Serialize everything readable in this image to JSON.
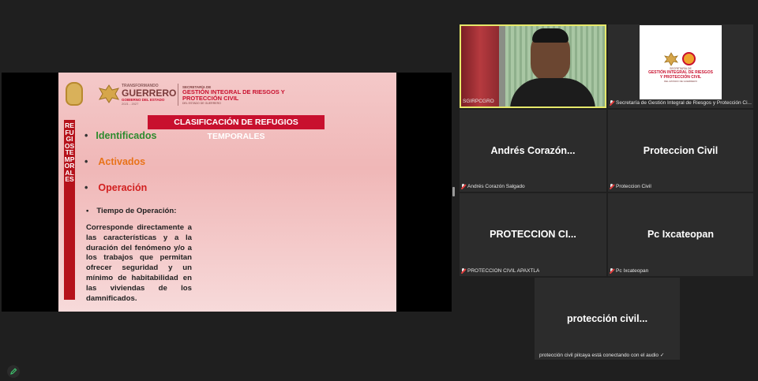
{
  "slide": {
    "logo_line1": "TRANSFORMANDO",
    "logo_line2": "GUERRERO",
    "logo_line3": "GOBIERNO DEL ESTADO",
    "logo_line4": "2021 - 2027",
    "sec_line1": "SECRETARÍA DE",
    "sec_line2": "GESTIÓN INTEGRAL DE RIESGOS Y",
    "sec_line3": "PROTECCIÓN CIVIL",
    "sec_line4": "DEL ESTADO DE GUERRERO",
    "vertical_label": "REFUGIOS TEMPORALES",
    "title": "CLASIFICACIÓN DE REFUGIOS TEMPORALES",
    "items": [
      "Identificados",
      "Activados",
      "Operación"
    ],
    "item_colors": [
      "#2e8b2e",
      "#e8731a",
      "#d21f1f"
    ],
    "sub_item": "Tiempo de Operación:",
    "body": "Corresponde directamente a las características y a la duración del fenómeno y/o a los trabajos que permitan ofrecer seguridad y un mínimo de habitabilidad en las viviendas de los damnificados."
  },
  "participants": {
    "p1_caption": "SGIRPCGRO",
    "p2_caption": "Secretaría de Gestión Integral de Riesgos y Protección Ci...",
    "p2_logo_line1": "SECRETARÍA DE",
    "p2_logo_line2": "GESTIÓN INTEGRAL DE RIESGOS",
    "p2_logo_line3": "Y PROTECCIÓN CIVIL",
    "p2_logo_line4": "DEL ESTADO DE GUERRERO",
    "p3_name": "Andrés  Corazón...",
    "p3_caption": "Andrés Corazón Salgado",
    "p4_name": "Proteccion Civil",
    "p4_caption": "Proteccion Civil",
    "p5_name": "PROTECCION CI...",
    "p5_caption": "PROTECCION CIVIL APAXTLA",
    "p6_name": "Pc Ixcateopan",
    "p6_caption": "Pc Ixcateopan",
    "p7_name": "protección civil...",
    "p7_caption": "protección civil pilcaya  está conectando con el audio ✓"
  },
  "colors": {
    "speaker_border": "#e6e86a",
    "accent_red": "#c8102e"
  }
}
